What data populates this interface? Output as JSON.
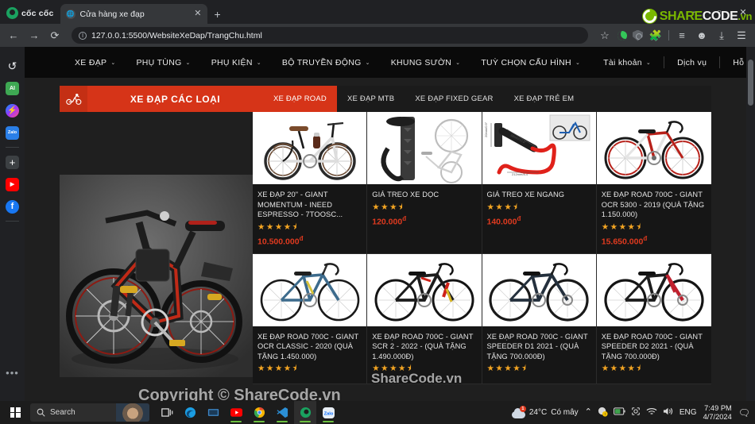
{
  "browser": {
    "brand": "cốc cốc",
    "tab": {
      "title": "Cửa hàng xe đạp",
      "close": "✕"
    },
    "new_tab": "+",
    "url": "127.0.0.1:5500/WebsiteXeDap/TrangChu.html",
    "nav": {
      "back": "←",
      "forward": "→",
      "reload": "⟳"
    },
    "toolbar_icons": [
      "star-icon",
      "night-mode-icon",
      "adblock-shield-icon",
      "extensions-icon",
      "reading-list-icon",
      "profile-icon",
      "downloads-icon",
      "menu-icon"
    ],
    "window_controls": [
      "minimize",
      "maximize",
      "close"
    ]
  },
  "watermark_badge": {
    "share": "SHARE",
    "code": "CODE",
    "vn": ".vn"
  },
  "sidebar": {
    "items": [
      {
        "name": "history-icon",
        "glyph": "↺",
        "color": "#e8eaed",
        "type": "glyph"
      },
      {
        "name": "ai-icon",
        "glyph": "AI",
        "color": "#3ea853",
        "type": "square"
      },
      {
        "name": "messenger-icon",
        "glyph": "",
        "color": "#a033ff",
        "type": "circle"
      },
      {
        "name": "zalo-icon",
        "glyph": "Zalo",
        "color": "#0068ff",
        "type": "square"
      },
      {
        "name": "add-icon",
        "glyph": "+",
        "color": "#3c4043",
        "type": "square"
      },
      {
        "name": "youtube-icon",
        "glyph": "▶",
        "color": "#ff0000",
        "type": "square"
      },
      {
        "name": "facebook-icon",
        "glyph": "f",
        "color": "#1877f2",
        "type": "circle"
      },
      {
        "name": "more-icon",
        "glyph": "•••",
        "color": "#9aa0a6",
        "type": "dots"
      }
    ]
  },
  "site": {
    "nav_left": [
      {
        "label": "XE ĐẠP",
        "caret": "⌄"
      },
      {
        "label": "PHỤ TÙNG",
        "caret": "⌄"
      },
      {
        "label": "PHỤ KIỆN",
        "caret": "⌄"
      },
      {
        "label": "BỘ TRUYỀN ĐỘNG",
        "caret": "⌄"
      },
      {
        "label": "KHUNG SƯỜN",
        "caret": "⌄"
      },
      {
        "label": "TUỲ CHỌN CẤU HÌNH",
        "caret": "⌄"
      }
    ],
    "nav_right": [
      {
        "label": "Tài khoản",
        "caret": "⌄"
      },
      {
        "label": "Dịch vụ",
        "caret": ""
      },
      {
        "label": "Hỗ trợ",
        "caret": ""
      }
    ],
    "cart_icon": "🛒",
    "category_bar": {
      "main_label": "XE ĐẠP CÁC LOẠI",
      "main_icon": "cyclist-icon",
      "tabs": [
        {
          "label": "XE ĐẠP ROAD",
          "active": true
        },
        {
          "label": "XE ĐẠP MTB",
          "active": false
        },
        {
          "label": "XE ĐẠP FIXED GEAR",
          "active": false
        },
        {
          "label": "XE ĐẠP TRẺ EM",
          "active": false
        }
      ]
    },
    "hero": {
      "name": "featured-bike-image",
      "alt": "Xe đạp địa hình đen đỏ"
    },
    "products": [
      {
        "title": "XE ĐẠP 20\" - GIANT MOMENTUM - INEED ESPRESSO - 7TOOSC...",
        "rating": 4.5,
        "price": "10.500.000",
        "currency": "đ",
        "image": "white-folding-bike"
      },
      {
        "title": "GIÁ TREO XE DỌC",
        "rating": 3.5,
        "price": "120.000",
        "currency": "đ",
        "image": "vertical-bike-rack"
      },
      {
        "title": "GIÁ TREO XE NGANG",
        "rating": 3.5,
        "price": "140.000",
        "currency": "đ",
        "image": "horizontal-bike-hook"
      },
      {
        "title": "XE ĐẠP ROAD 700C - GIANT OCR 5300 - 2019 (QUÀ TẶNG 1.150.000)",
        "rating": 4.5,
        "price": "15.650.000",
        "currency": "đ",
        "image": "red-white-road-bike"
      },
      {
        "title": "XE ĐẠP ROAD 700C - GIANT OCR CLASSIC - 2020 (QUÀ TẶNG 1.450.000)",
        "rating": 4.5,
        "price": "",
        "currency": "",
        "image": "blue-road-bike"
      },
      {
        "title": "XE ĐẠP ROAD 700C - GIANT SCR 2 - 2022 - (QUÀ TẶNG 1.490.000Đ)",
        "rating": 4.5,
        "price": "",
        "currency": "",
        "image": "black-red-road-bike"
      },
      {
        "title": "XE ĐẠP ROAD 700C - GIANT SPEEDER D1 2021 - (QUÀ TẶNG 700.000Đ)",
        "rating": 4.5,
        "price": "",
        "currency": "",
        "image": "dark-blue-road-bike"
      },
      {
        "title": "XE ĐẠP ROAD 700C - GIANT SPEEDER D2 2021 - (QUÀ TẶNG 700.000Đ)",
        "rating": 4.5,
        "price": "",
        "currency": "",
        "image": "black-crimson-road-bike"
      }
    ]
  },
  "overlay_watermarks": [
    {
      "text": "Copyright © ShareCode.vn"
    },
    {
      "text": "ShareCode.vn"
    }
  ],
  "taskbar": {
    "start": "start-button",
    "search": {
      "placeholder": "Search",
      "value": ""
    },
    "apps": [
      {
        "name": "task-view-icon",
        "color": "#e8e8e8",
        "underline": ""
      },
      {
        "name": "edge-icon",
        "color": "#2196c9",
        "underline": ""
      },
      {
        "name": "file-explorer-icon",
        "color": "#4a9fd8",
        "underline": ""
      },
      {
        "name": "youtube-icon",
        "color": "#ff0000",
        "underline": "#6bbf3f"
      },
      {
        "name": "chrome-icon",
        "color": "#f4b400",
        "underline": "#6bbf3f"
      },
      {
        "name": "vscode-icon",
        "color": "#2b8fd6",
        "underline": "#6bbf3f"
      },
      {
        "name": "coccoc-icon",
        "color": "#1aa260",
        "underline": "#6bbf3f"
      },
      {
        "name": "zalo-icon",
        "color": "#0068ff",
        "underline": "#6bbf3f"
      }
    ],
    "weather": {
      "temp": "24°C",
      "desc": "Có mây",
      "badge": "1"
    },
    "tray": {
      "chevron": "⌃",
      "icons": [
        "update-icon",
        "battery-icon",
        "camera-icon",
        "wifi-icon",
        "volume-icon"
      ],
      "language": "ENG"
    },
    "clock": {
      "time": "7:49 PM",
      "date": "4/7/2024"
    },
    "notifications": "notification-icon"
  }
}
